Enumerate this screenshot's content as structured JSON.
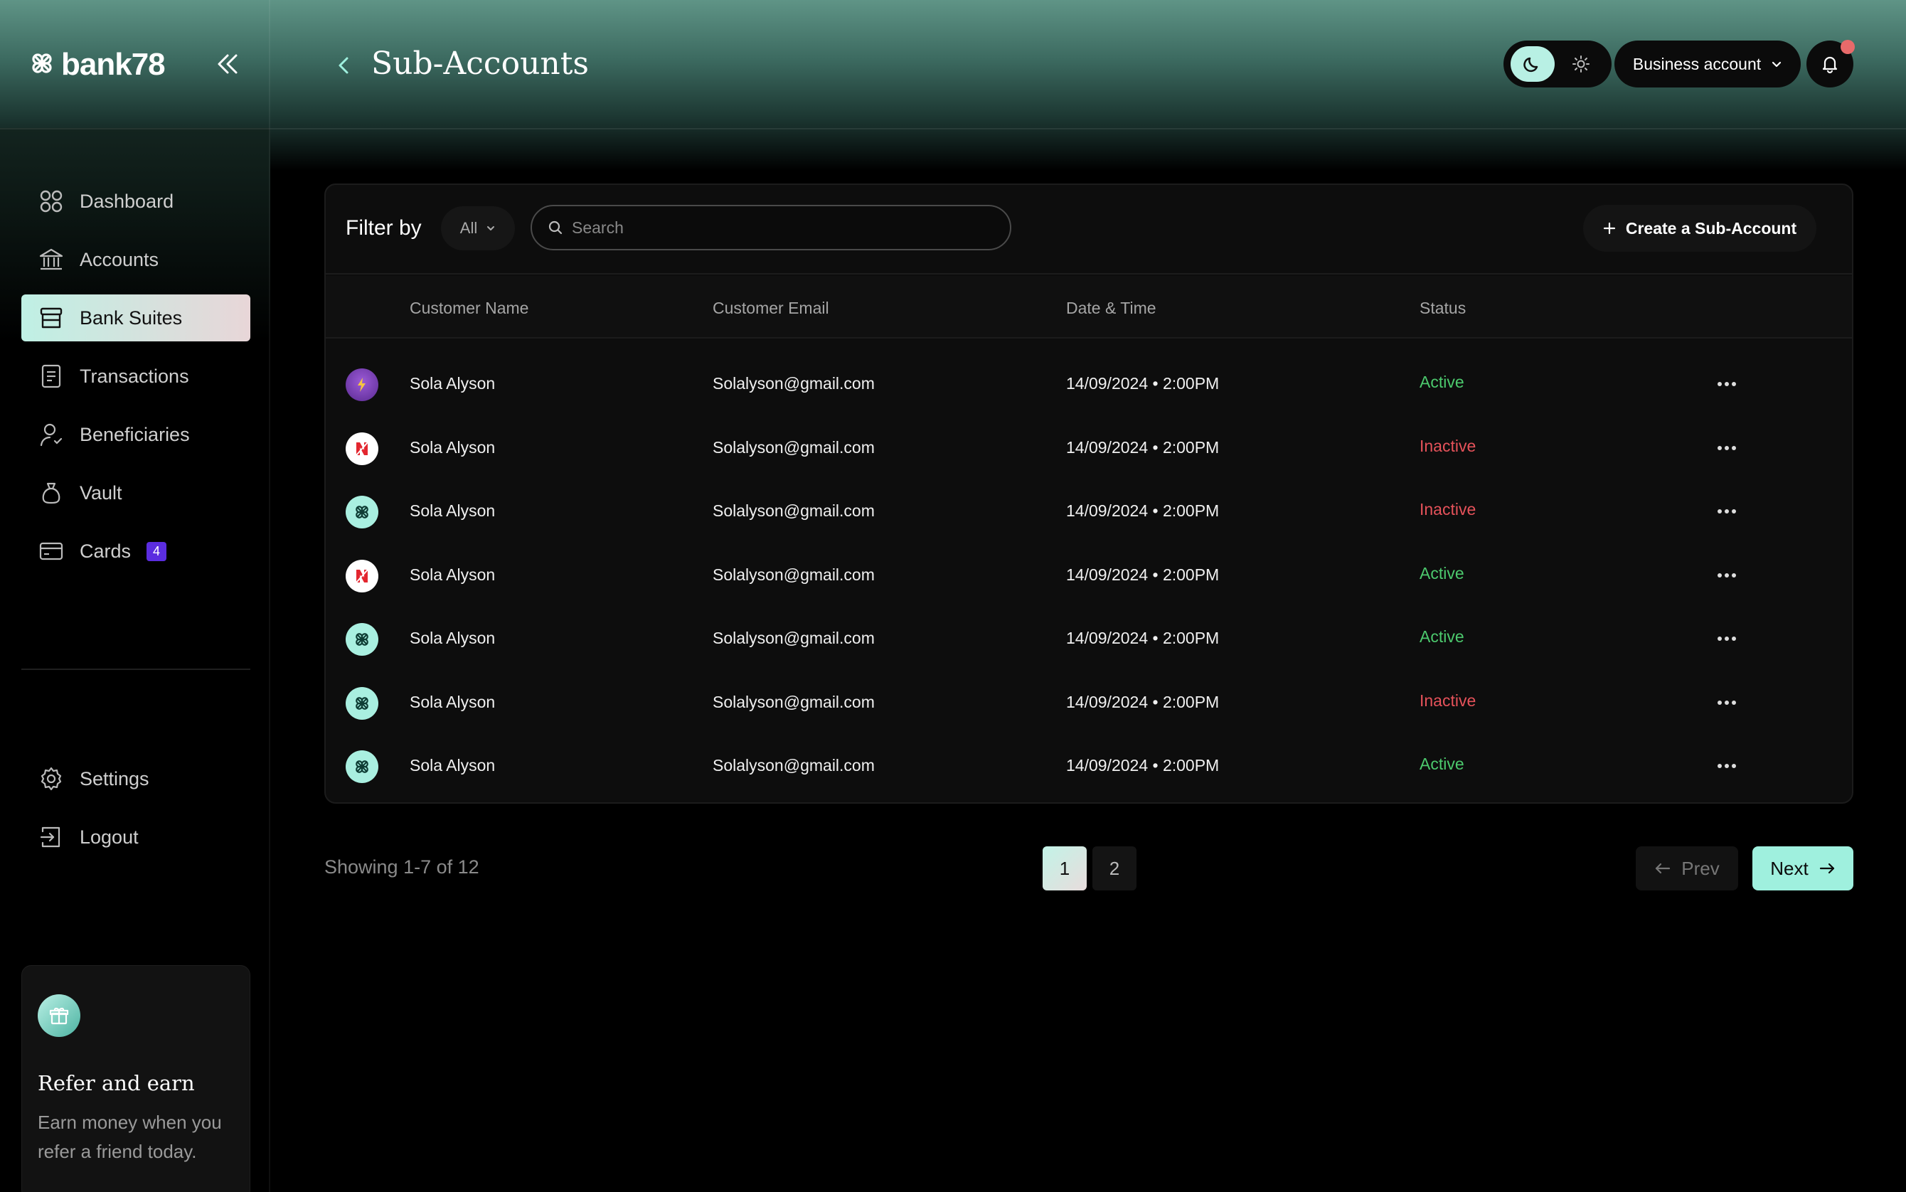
{
  "app": {
    "name": "bank78"
  },
  "header": {
    "title": "Sub-Accounts",
    "account_select": "Business account"
  },
  "sidebar": {
    "items": [
      {
        "label": "Dashboard"
      },
      {
        "label": "Accounts"
      },
      {
        "label": "Bank Suites",
        "active": true
      },
      {
        "label": "Transactions"
      },
      {
        "label": "Beneficiaries"
      },
      {
        "label": "Vault"
      },
      {
        "label": "Cards",
        "badge": "4"
      }
    ],
    "bottom_items": [
      {
        "label": "Settings"
      },
      {
        "label": "Logout"
      }
    ],
    "refer": {
      "title": "Refer and earn",
      "description": "Earn money when you refer a friend today."
    }
  },
  "toolbar": {
    "filter_label": "Filter by",
    "filter_value": "All",
    "search_placeholder": "Search",
    "create_button": "Create a Sub-Account"
  },
  "table": {
    "headers": {
      "name": "Customer Name",
      "email": "Customer Email",
      "datetime": "Date & Time",
      "status": "Status"
    },
    "rows": [
      {
        "avatar": "purple-logo",
        "name": "Sola Alyson",
        "email": "Solalyson@gmail.com",
        "datetime": "14/09/2024 • 2:00PM",
        "status": "Active"
      },
      {
        "avatar": "red-n-logo",
        "name": "Sola Alyson",
        "email": "Solalyson@gmail.com",
        "datetime": "14/09/2024 • 2:00PM",
        "status": "Inactive"
      },
      {
        "avatar": "mint-flower-logo",
        "name": "Sola Alyson",
        "email": "Solalyson@gmail.com",
        "datetime": "14/09/2024 • 2:00PM",
        "status": "Inactive"
      },
      {
        "avatar": "red-n-logo",
        "name": "Sola Alyson",
        "email": "Solalyson@gmail.com",
        "datetime": "14/09/2024 • 2:00PM",
        "status": "Active"
      },
      {
        "avatar": "mint-flower-logo",
        "name": "Sola Alyson",
        "email": "Solalyson@gmail.com",
        "datetime": "14/09/2024 • 2:00PM",
        "status": "Active"
      },
      {
        "avatar": "mint-flower-logo",
        "name": "Sola Alyson",
        "email": "Solalyson@gmail.com",
        "datetime": "14/09/2024 • 2:00PM",
        "status": "Inactive"
      },
      {
        "avatar": "mint-flower-logo",
        "name": "Sola Alyson",
        "email": "Solalyson@gmail.com",
        "datetime": "14/09/2024 • 2:00PM",
        "status": "Active"
      }
    ]
  },
  "pagination": {
    "showing": "Showing 1-7 of 12",
    "pages": [
      "1",
      "2"
    ],
    "current": "1",
    "prev": "Prev",
    "next": "Next"
  },
  "colors": {
    "accent": "#9ff0de",
    "active": "#4cc96d",
    "inactive": "#e5525a",
    "badge": "#5b2de0"
  }
}
